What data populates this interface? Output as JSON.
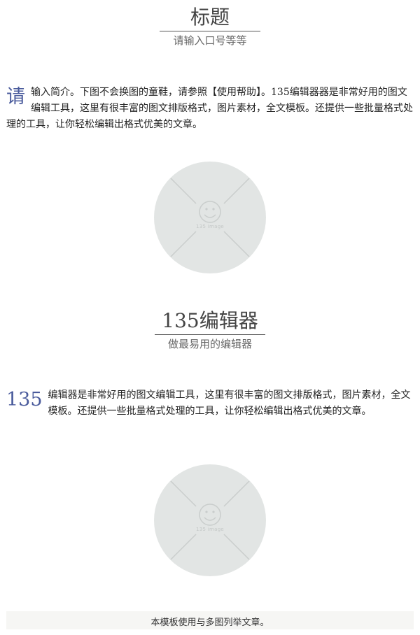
{
  "header": {
    "title": "标题",
    "subtitle": "请输入口号等等"
  },
  "intro1": {
    "dropcap": "请",
    "text": "输入简介。下图不会换图的童鞋，请参照【使用帮助】。135编辑器器是非常好用的图文编辑工具，这里有很丰富的图文排版格式，图片素材，全文模板。还提供一些批量格式处理的工具，让你轻松编辑出格式优美的文章。"
  },
  "image1": {
    "caption": "135 image",
    "icon": "smiley-icon"
  },
  "section2": {
    "title": "135编辑器",
    "subtitle": "做最易用的编辑器"
  },
  "intro2": {
    "dropcap": "135",
    "text": "编辑器是非常好用的图文编辑工具，这里有很丰富的图文排版格式，图片素材，全文模板。还提供一些批量格式处理的工具，让你轻松编辑出格式优美的文章。"
  },
  "image2": {
    "caption": "135 image",
    "icon": "smiley-icon"
  },
  "footer": {
    "text": "本模板使用与多图列举文章。"
  },
  "colors": {
    "accent": "#4a5b9c",
    "placeholder_bg": "#e2e5e4",
    "placeholder_lines": "#c9cdcc"
  }
}
